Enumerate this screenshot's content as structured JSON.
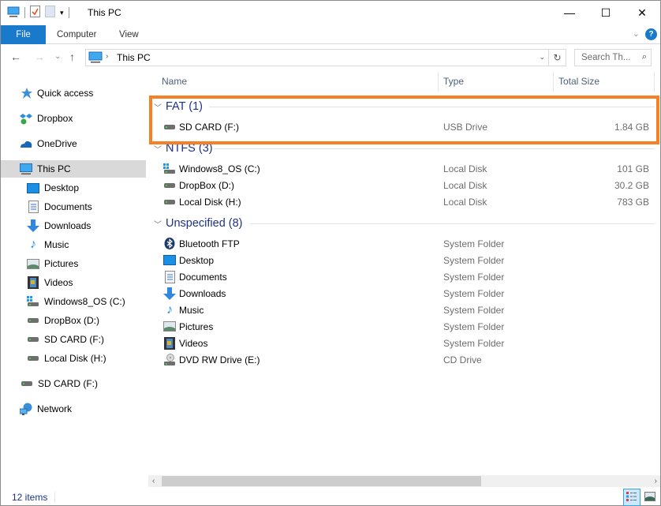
{
  "titlebar": {
    "title": "This PC",
    "qat_icons": [
      "computer-icon",
      "properties-icon",
      "new-folder-icon",
      "customize-dropdown-icon"
    ],
    "minimize_glyph": "—",
    "maximize_glyph": "☐",
    "close_glyph": "✕"
  },
  "ribbon": {
    "tabs": [
      {
        "label": "File",
        "active": true
      },
      {
        "label": "Computer"
      },
      {
        "label": "View"
      }
    ],
    "expand_glyph": "⌄",
    "help_glyph": "?"
  },
  "navbar": {
    "back_glyph": "←",
    "forward_glyph": "→",
    "recent_glyph": "⌄",
    "up_glyph": "↑",
    "address": {
      "separator": "›",
      "path": "This PC",
      "dropdown_glyph": "⌄",
      "refresh_glyph": "↻"
    },
    "search": {
      "placeholder": "Search Th...",
      "icon_glyph": "⌕"
    }
  },
  "sidebar": {
    "items": [
      {
        "label": "Quick access",
        "icon": "star-icon",
        "level": 0
      },
      {
        "label": "Dropbox",
        "icon": "dropbox-icon",
        "level": 0
      },
      {
        "label": "OneDrive",
        "icon": "onedrive-icon",
        "level": 0
      },
      {
        "label": "This PC",
        "icon": "computer-icon",
        "level": 0,
        "selected": true
      },
      {
        "label": "Desktop",
        "icon": "desktop-icon",
        "level": 1
      },
      {
        "label": "Documents",
        "icon": "documents-icon",
        "level": 1
      },
      {
        "label": "Downloads",
        "icon": "downloads-icon",
        "level": 1
      },
      {
        "label": "Music",
        "icon": "music-icon",
        "level": 1
      },
      {
        "label": "Pictures",
        "icon": "pictures-icon",
        "level": 1
      },
      {
        "label": "Videos",
        "icon": "videos-icon",
        "level": 1
      },
      {
        "label": "Windows8_OS (C:)",
        "icon": "os-drive-icon",
        "level": 1
      },
      {
        "label": "DropBox (D:)",
        "icon": "drive-icon",
        "level": 1
      },
      {
        "label": "SD CARD (F:)",
        "icon": "drive-icon",
        "level": 1
      },
      {
        "label": "Local Disk (H:)",
        "icon": "drive-icon",
        "level": 1
      },
      {
        "label": "SD CARD (F:)",
        "icon": "drive-icon",
        "level": 0
      },
      {
        "label": "Network",
        "icon": "network-icon",
        "level": 0
      }
    ]
  },
  "columns": {
    "name": "Name",
    "type": "Type",
    "size": "Total Size"
  },
  "groups": [
    {
      "label": "FAT (1)",
      "highlighted": true,
      "items": [
        {
          "name": "SD CARD (F:)",
          "type": "USB Drive",
          "size": "1.84 GB",
          "icon": "drive-icon"
        }
      ]
    },
    {
      "label": "NTFS (3)",
      "items": [
        {
          "name": "Windows8_OS (C:)",
          "type": "Local Disk",
          "size": "101 GB",
          "icon": "os-drive-icon"
        },
        {
          "name": "DropBox (D:)",
          "type": "Local Disk",
          "size": "30.2 GB",
          "icon": "drive-icon"
        },
        {
          "name": "Local Disk (H:)",
          "type": "Local Disk",
          "size": "783 GB",
          "icon": "drive-icon"
        }
      ]
    },
    {
      "label": "Unspecified (8)",
      "items": [
        {
          "name": "Bluetooth FTP",
          "type": "System Folder",
          "size": "",
          "icon": "bluetooth-icon"
        },
        {
          "name": "Desktop",
          "type": "System Folder",
          "size": "",
          "icon": "desktop-icon"
        },
        {
          "name": "Documents",
          "type": "System Folder",
          "size": "",
          "icon": "documents-icon"
        },
        {
          "name": "Downloads",
          "type": "System Folder",
          "size": "",
          "icon": "downloads-icon"
        },
        {
          "name": "Music",
          "type": "System Folder",
          "size": "",
          "icon": "music-icon"
        },
        {
          "name": "Pictures",
          "type": "System Folder",
          "size": "",
          "icon": "pictures-icon"
        },
        {
          "name": "Videos",
          "type": "System Folder",
          "size": "",
          "icon": "videos-icon"
        },
        {
          "name": "DVD RW Drive (E:)",
          "type": "CD Drive",
          "size": "",
          "icon": "dvd-drive-icon"
        }
      ]
    }
  ],
  "scrollbar": {
    "left_glyph": "‹",
    "right_glyph": "›"
  },
  "status": {
    "item_count": "12 items",
    "views": [
      "details-view",
      "large-icons-view"
    ],
    "active_view": "details-view"
  },
  "colors": {
    "accent": "#1979ca",
    "highlight_box": "#f58025",
    "group_header": "#1e3287",
    "selected_bg": "#d9d9d9"
  }
}
